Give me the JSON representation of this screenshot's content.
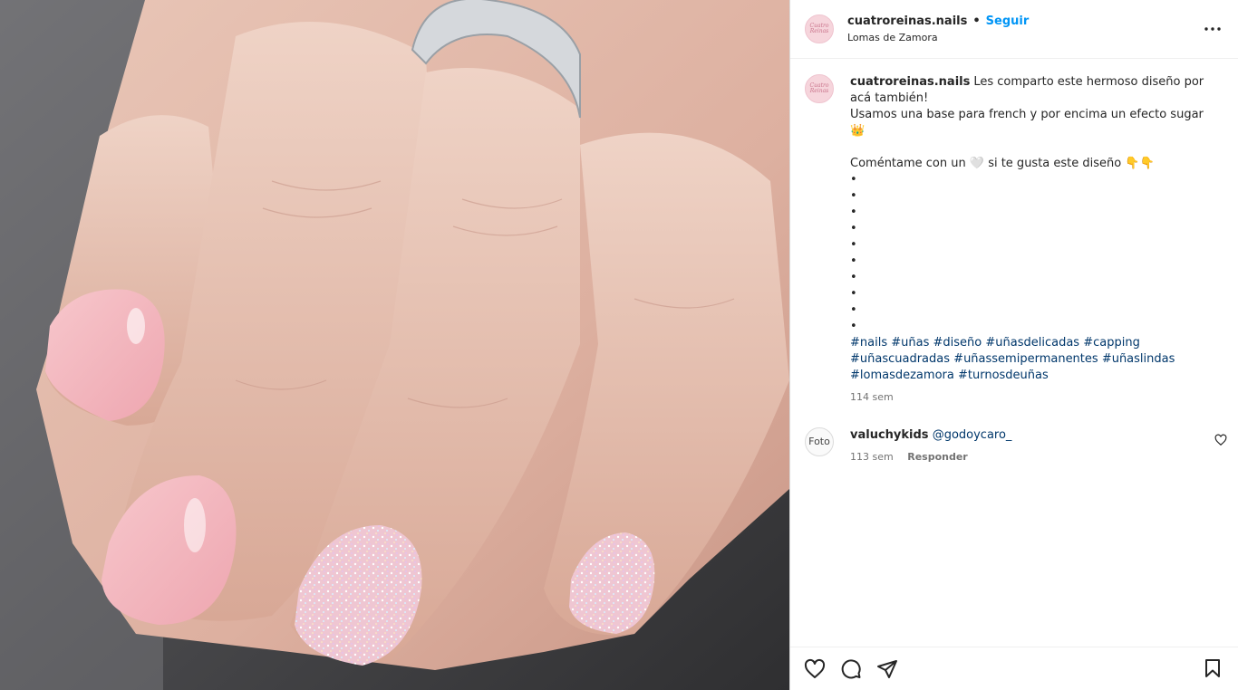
{
  "post": {
    "account": {
      "username": "cuatroreinas.nails",
      "follow_label": "Seguir",
      "location": "Lomas de Zamora",
      "avatar_text": "Cuatro Reinas",
      "avatar_color": "#f6d5dc"
    },
    "media": {
      "icon": "photo-hand-nails"
    },
    "caption": {
      "username": "cuatroreinas.nails",
      "line1": "Les comparto este hermoso diseño por acá también!",
      "line2": "Usamos una base para french y por encima un efecto sugar 👑",
      "line3": "Coméntame con un 🤍 si te gusta este diseño 👇👇",
      "bullets": [
        "•",
        "•",
        "•",
        "•",
        "•",
        "•",
        "•",
        "•",
        "•",
        "•"
      ],
      "hashtags": [
        "#nails",
        "#uñas",
        "#diseño",
        "#uñasdelicadas",
        "#capping",
        "#uñascuadradas",
        "#uñassemipermanentes",
        "#uñaslindas",
        "#lomasdezamora",
        "#turnosdeuñas"
      ],
      "time": "114 sem"
    },
    "comments": [
      {
        "avatar_text": "Foto",
        "username": "valuchykids",
        "text": "@godoycaro_",
        "time": "113 sem",
        "reply_label": "Responder"
      }
    ],
    "actions": {
      "like_icon": "heart-icon",
      "comment_icon": "comment-icon",
      "share_icon": "send-icon",
      "save_icon": "bookmark-icon"
    },
    "colors": {
      "link": "#0095f6",
      "hashtag": "#00376b",
      "muted": "#737373"
    }
  }
}
